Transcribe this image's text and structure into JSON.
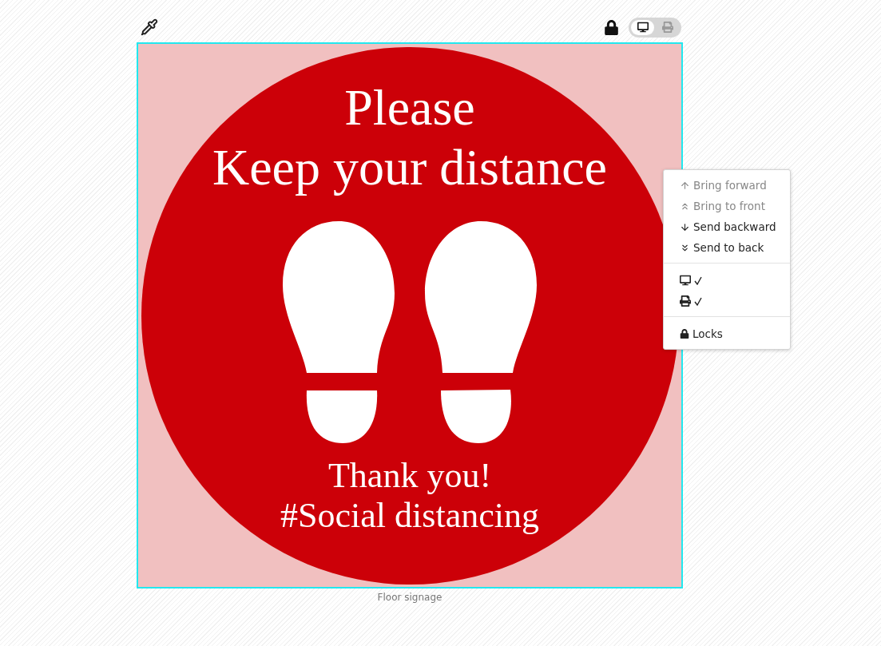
{
  "toolbar": {
    "view_modes": [
      {
        "kind": "screen",
        "selected": true
      },
      {
        "kind": "print",
        "selected": false
      }
    ]
  },
  "sign": {
    "headline": [
      "Please",
      "Keep your distance"
    ],
    "footer": [
      "Thank you!",
      "#Social distancing"
    ]
  },
  "caption": "Floor signage",
  "context_menu": {
    "arrange": [
      {
        "label": "Bring forward",
        "disabled": true
      },
      {
        "label": "Bring to front",
        "disabled": true
      },
      {
        "label": "Send backward",
        "disabled": false
      },
      {
        "label": "Send to back",
        "disabled": false
      }
    ],
    "visibility": [
      {
        "kind": "screen",
        "checked": true
      },
      {
        "kind": "print",
        "checked": true
      }
    ],
    "locks": {
      "label": "Locks"
    }
  }
}
